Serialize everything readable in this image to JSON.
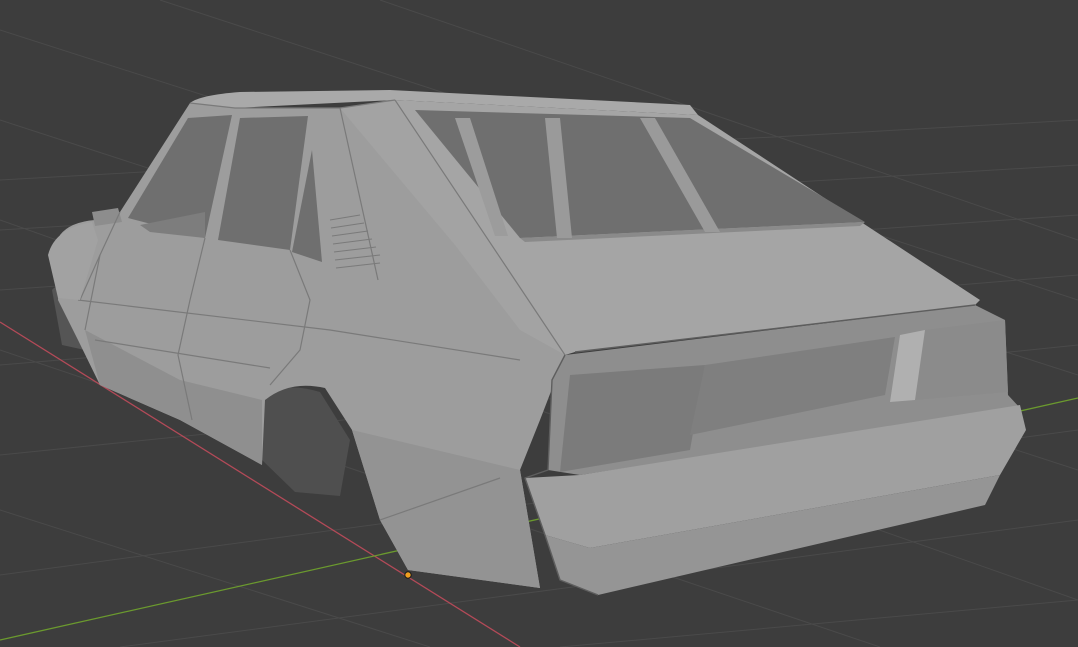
{
  "viewport": {
    "background": "#3d3d3d",
    "grid_color": "#4a4a4a",
    "axis_x_color": "#b34a58",
    "axis_y_color": "#6b9a2e",
    "origin_color": "#f0a020",
    "object": "car-body-mesh",
    "shading": "solid"
  }
}
